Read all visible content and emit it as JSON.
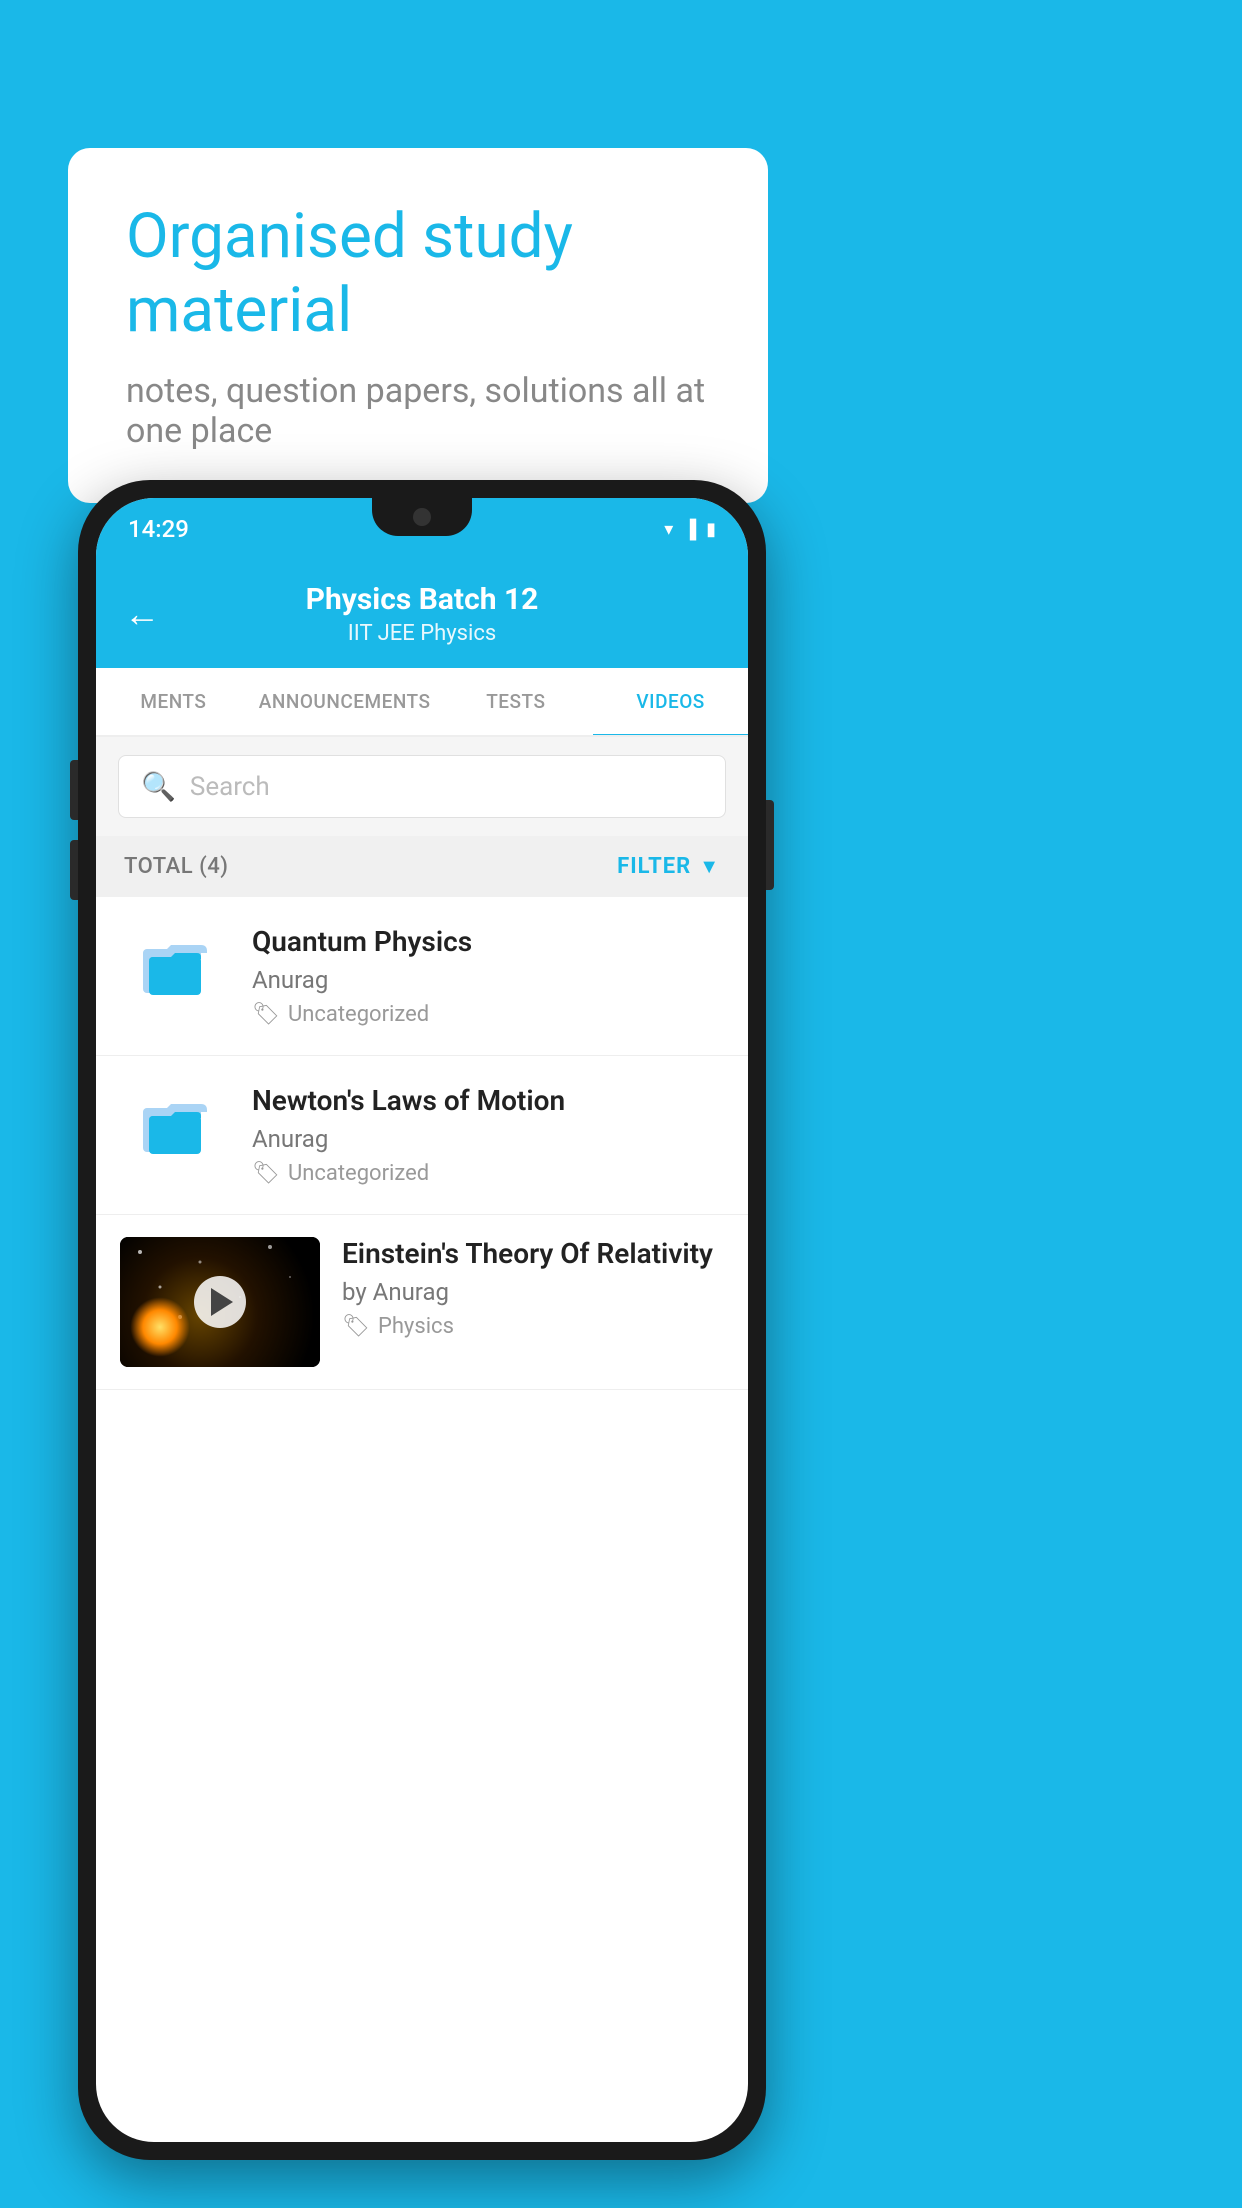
{
  "background": {
    "color": "#1ab8e8"
  },
  "speech_bubble": {
    "title": "Organised study material",
    "subtitle": "notes, question papers, solutions all at one place"
  },
  "phone": {
    "status_bar": {
      "time": "14:29"
    },
    "header": {
      "back_label": "←",
      "title": "Physics Batch 12",
      "subtitle": "IIT JEE   Physics"
    },
    "tabs": [
      {
        "label": "MENTS",
        "active": false
      },
      {
        "label": "ANNOUNCEMENTS",
        "active": false
      },
      {
        "label": "TESTS",
        "active": false
      },
      {
        "label": "VIDEOS",
        "active": true
      }
    ],
    "search": {
      "placeholder": "Search"
    },
    "filter": {
      "total_label": "TOTAL (4)",
      "filter_label": "FILTER"
    },
    "videos": [
      {
        "title": "Quantum Physics",
        "author": "Anurag",
        "tag": "Uncategorized",
        "type": "folder"
      },
      {
        "title": "Newton's Laws of Motion",
        "author": "Anurag",
        "tag": "Uncategorized",
        "type": "folder"
      },
      {
        "title": "Einstein's Theory Of Relativity",
        "author": "by Anurag",
        "tag": "Physics",
        "type": "video"
      }
    ]
  }
}
